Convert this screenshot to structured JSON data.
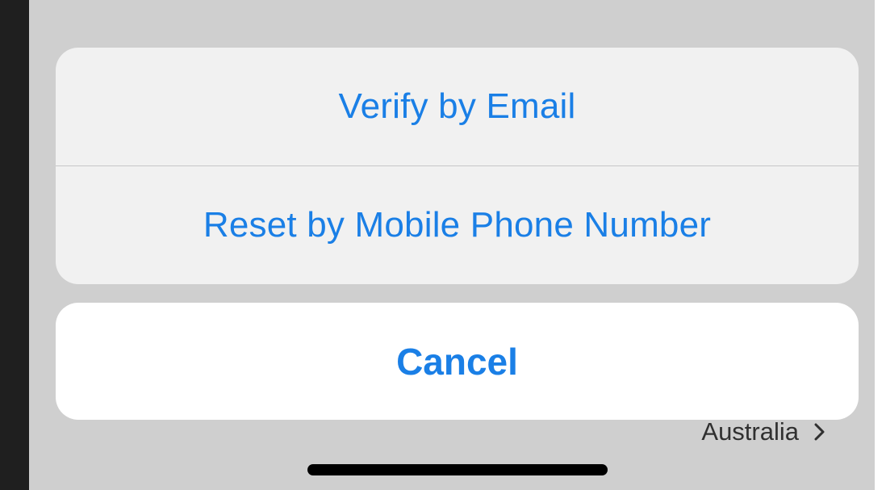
{
  "action_sheet": {
    "options": [
      {
        "label": "Verify by Email"
      },
      {
        "label": "Reset by Mobile Phone Number"
      }
    ],
    "cancel_label": "Cancel"
  },
  "underlay": {
    "region_value": "Australia",
    "chevron_icon": "chevron-right-icon"
  },
  "colors": {
    "accent": "#1a7fe6",
    "sheet_background": "#f1f1f1",
    "cancel_background": "#ffffff",
    "dimmed_background": "#cfcfcf"
  }
}
